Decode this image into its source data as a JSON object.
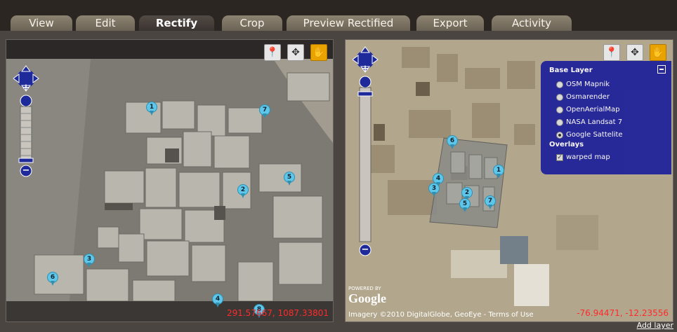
{
  "tabs": [
    {
      "label": "View",
      "active": false
    },
    {
      "label": "Edit",
      "active": false
    },
    {
      "label": "Rectify",
      "active": true
    },
    {
      "label": "Crop",
      "active": false
    },
    {
      "label": "Preview Rectified",
      "active": false
    },
    {
      "label": "Export",
      "active": false
    },
    {
      "label": "Activity",
      "active": false
    }
  ],
  "left_map": {
    "toolbar": {
      "add_point_icon": "map-pin-icon",
      "move_icon": "move-arrows-icon",
      "pan_icon": "hand-icon"
    },
    "markers": [
      "1",
      "7",
      "5",
      "2",
      "3",
      "6",
      "4",
      "8"
    ],
    "coordinates": "291.57667, 1087.33801"
  },
  "right_map": {
    "toolbar": {
      "add_point_icon": "map-pin-icon",
      "move_icon": "move-arrows-icon",
      "pan_icon": "hand-icon"
    },
    "markers": [
      "6",
      "1",
      "4",
      "2",
      "7",
      "5",
      "3"
    ],
    "layer_switcher": {
      "base_layer_title": "Base Layer",
      "base_layers": [
        "OSM Mapnik",
        "Osmarender",
        "OpenAerialMap",
        "NASA Landsat 7",
        "Google Sattelite"
      ],
      "selected_base_layer": "Google Sattelite",
      "overlays_title": "Overlays",
      "overlays": [
        "warped map"
      ]
    },
    "powered_by": "POWERED BY",
    "google_logo": "Google",
    "attribution": "Imagery ©2010 DigitalGlobe, GeoEye - ",
    "terms_link": "Terms of Use",
    "coordinates": "-76.94471, -12.23556"
  },
  "add_layer_link": "Add layer",
  "zoom": {
    "plus": "+",
    "minus": "−"
  }
}
